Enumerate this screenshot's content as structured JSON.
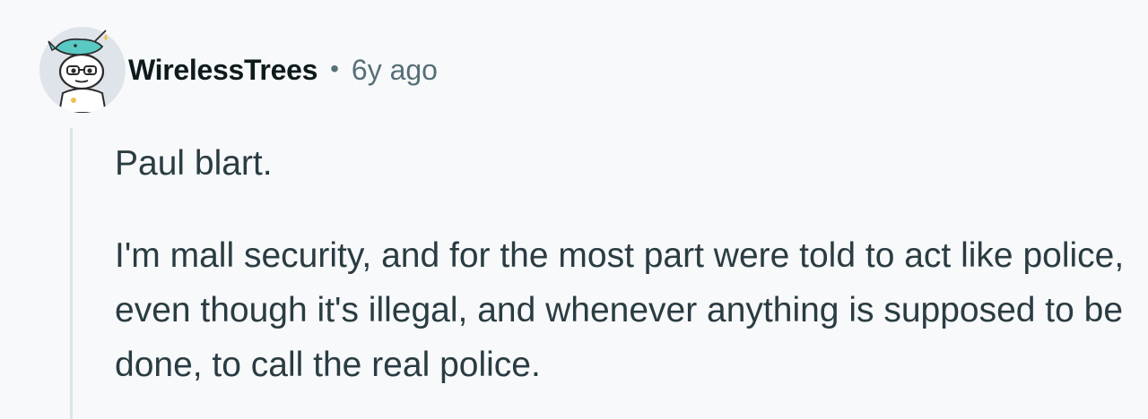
{
  "comment": {
    "author": "WirelessTrees",
    "separator": "•",
    "timestamp": "6y ago",
    "paragraphs": [
      "Paul blart.",
      "I'm mall security, and for the most part were told to act like police, even though it's illegal, and whenever anything is supposed to be done, to call the real police."
    ]
  },
  "avatar": {
    "icon": "snoo-avatar-with-narwhal-hat",
    "background_color": "#dfe4ea",
    "hat_color": "#5ac8c3"
  },
  "colors": {
    "page_background": "#f7f9fb",
    "author_text": "#0f1a1c",
    "meta_text": "#576f76",
    "body_text": "#2a3c42",
    "thread_line": "#dbe4e9"
  }
}
